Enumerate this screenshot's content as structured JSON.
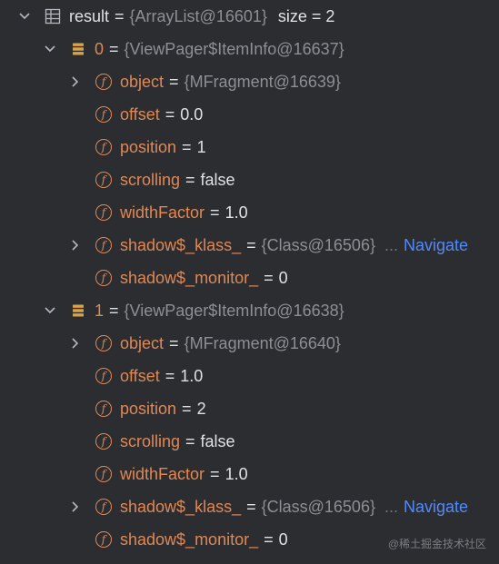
{
  "root": {
    "name": "result",
    "ref": "{ArrayList@16601}",
    "size": "size = 2"
  },
  "items": [
    {
      "name": "0",
      "ref": "{ViewPager$ItemInfo@16637}",
      "fields": [
        {
          "name": "object",
          "ref": "{MFragment@16639}",
          "expandable": true
        },
        {
          "name": "offset",
          "value": "0.0"
        },
        {
          "name": "position",
          "value": "1"
        },
        {
          "name": "scrolling",
          "value": "false"
        },
        {
          "name": "widthFactor",
          "value": "1.0"
        },
        {
          "name": "shadow$_klass_",
          "ref": "{Class@16506}",
          "expandable": true,
          "nav_ellipsis": "...",
          "nav": "Navigate"
        },
        {
          "name": "shadow$_monitor_",
          "value": "0"
        }
      ]
    },
    {
      "name": "1",
      "ref": "{ViewPager$ItemInfo@16638}",
      "fields": [
        {
          "name": "object",
          "ref": "{MFragment@16640}",
          "expandable": true
        },
        {
          "name": "offset",
          "value": "1.0"
        },
        {
          "name": "position",
          "value": "2"
        },
        {
          "name": "scrolling",
          "value": "false"
        },
        {
          "name": "widthFactor",
          "value": "1.0"
        },
        {
          "name": "shadow$_klass_",
          "ref": "{Class@16506}",
          "expandable": true,
          "nav_ellipsis": "...",
          "nav": "Navigate"
        },
        {
          "name": "shadow$_monitor_",
          "value": "0"
        }
      ]
    }
  ],
  "eq": "=",
  "watermark": "@稀土掘金技术社区",
  "colors": {
    "background": "#2b2d30",
    "field": "#e08855",
    "ref": "#8c8f94",
    "link": "#548af7"
  },
  "icons": {
    "expanded": "chevron-down-icon",
    "collapsed": "chevron-right-icon",
    "field": "field-icon",
    "list": "list-icon",
    "object": "object-icon"
  }
}
